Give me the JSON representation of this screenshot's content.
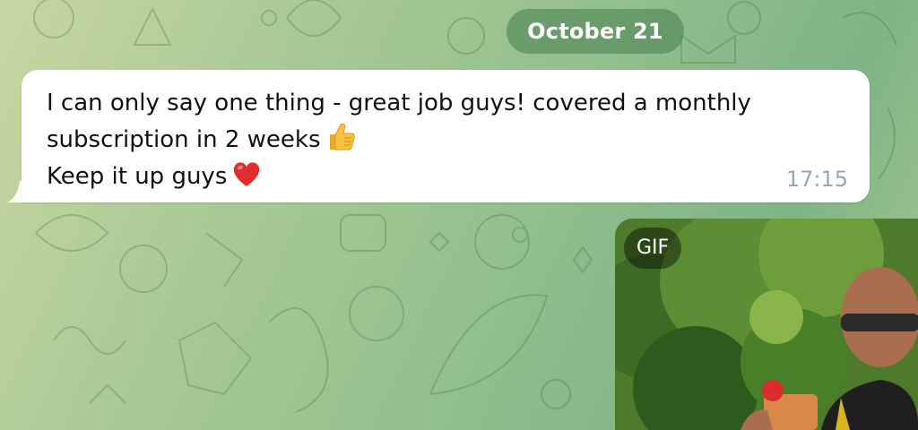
{
  "chat": {
    "date_label": "October 21",
    "message": {
      "line1": "I can only say one thing - great job guys! covered a monthly",
      "line2": "subscription in 2 weeks",
      "line3": "Keep it up guys",
      "emoji_1": "thumbs-up",
      "emoji_2": "red-heart",
      "time": "17:15"
    },
    "gif_message": {
      "badge": "GIF"
    }
  },
  "colors": {
    "wallpaper_start": "#c7d7a3",
    "wallpaper_end": "#7fb486",
    "bubble": "#ffffff",
    "timestamp": "#9aa5ae",
    "date_pill": "#4f8456"
  }
}
